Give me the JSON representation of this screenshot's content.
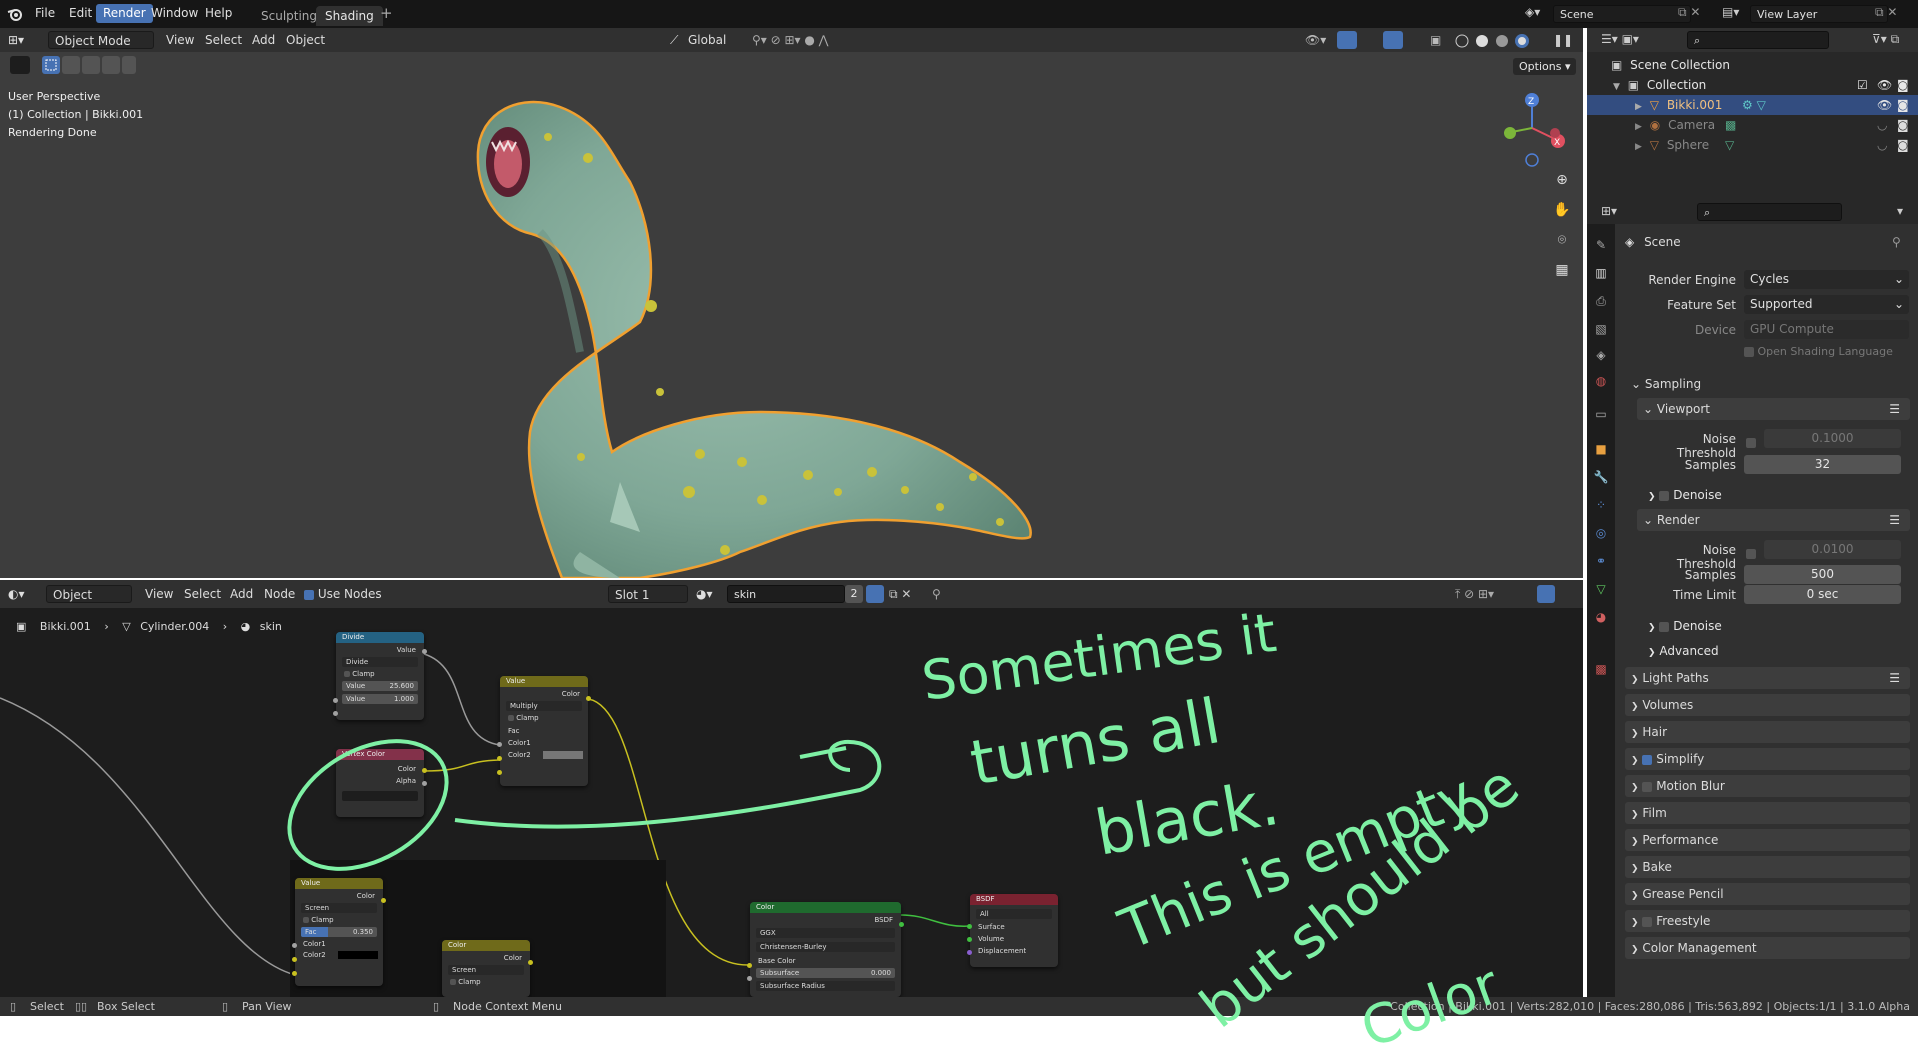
{
  "topbar": {
    "menus": [
      "File",
      "Edit",
      "Render",
      "Window",
      "Help"
    ],
    "workspaces": [
      "Sculpting",
      "Shading"
    ],
    "active_workspace": "Shading",
    "scene": "Scene",
    "view_layer": "View Layer"
  },
  "viewport": {
    "mode": "Object Mode",
    "menus": [
      "View",
      "Select",
      "Add",
      "Object"
    ],
    "transform": "Global",
    "options": "Options",
    "overlay_lines": [
      "User Perspective",
      "(1) Collection | Bikki.001",
      "Rendering Done"
    ]
  },
  "outliner": {
    "root": "Scene Collection",
    "collection": "Collection",
    "items": [
      "Bikki.001",
      "Camera",
      "Sphere"
    ]
  },
  "properties": {
    "context": "Scene",
    "render_engine_label": "Render Engine",
    "render_engine": "Cycles",
    "feature_set_label": "Feature Set",
    "feature_set": "Supported",
    "device_label": "Device",
    "device": "GPU Compute",
    "osl": "Open Shading Language",
    "sampling": "Sampling",
    "viewport": "Viewport",
    "render": "Render",
    "noise_threshold_label": "Noise Threshold",
    "samples_label": "Samples",
    "time_limit_label": "Time Limit",
    "viewport_noise": "0.1000",
    "viewport_samples": "32",
    "render_noise": "0.0100",
    "render_samples": "500",
    "time_limit": "0 sec",
    "denoise": "Denoise",
    "advanced": "Advanced",
    "sections": [
      "Light Paths",
      "Volumes",
      "Hair",
      "Simplify",
      "Motion Blur",
      "Film",
      "Performance",
      "Bake",
      "Grease Pencil",
      "Freestyle",
      "Color Management"
    ]
  },
  "node_editor": {
    "mode": "Object",
    "menus": [
      "View",
      "Select",
      "Add",
      "Node"
    ],
    "use_nodes": "Use Nodes",
    "slot": "Slot 1",
    "material": "skin",
    "users": "2",
    "breadcrumb": [
      "Bikki.001",
      "Cylinder.004",
      "skin"
    ],
    "nodes": {
      "divide": {
        "title": "Divide",
        "out": "Value",
        "op": "Divide",
        "clamp": "Clamp",
        "v1_label": "Value",
        "v1": "25.600",
        "v2_label": "Value",
        "v2": "1.000"
      },
      "vertex_color": {
        "title": "Vertex Color",
        "out1": "Color",
        "out2": "Alpha"
      },
      "value_mult": {
        "title": "Value",
        "out": "Color",
        "op": "Multiply",
        "clamp": "Clamp",
        "in1": "Fac",
        "in2": "Color1",
        "in3": "Color2"
      },
      "value_screen": {
        "title": "Value",
        "out": "Color",
        "op": "Screen",
        "clamp": "Clamp",
        "fac_label": "Fac",
        "fac": "0.350",
        "in2": "Color1",
        "in3": "Color2"
      },
      "color_small": {
        "title": "Color",
        "out": "Color",
        "op": "Screen",
        "clamp": "Clamp"
      },
      "bsdf_color": {
        "title": "Color",
        "out": "BSDF",
        "dist": "GGX",
        "sss": "Christensen-Burley",
        "base": "Base Color",
        "subsurface_label": "Subsurface",
        "subsurface": "0.000",
        "subsurface_radius": "Subsurface Radius"
      },
      "output": {
        "title": "BSDF",
        "target": "All",
        "in1": "Surface",
        "in2": "Volume",
        "in3": "Displacement"
      }
    }
  },
  "statusbar": {
    "items": [
      "Select",
      "Box Select",
      "Pan View",
      "Node Context Menu"
    ],
    "stats": "Collection | Bikki.001 | Verts:282,010 | Faces:280,086 | Tris:563,892 | Objects:1/1 | 3.1.0 Alpha"
  },
  "annotation": {
    "lines": [
      "Sometimes it",
      "turns all",
      "black.",
      "This is empty",
      "but should be",
      "Color"
    ]
  }
}
